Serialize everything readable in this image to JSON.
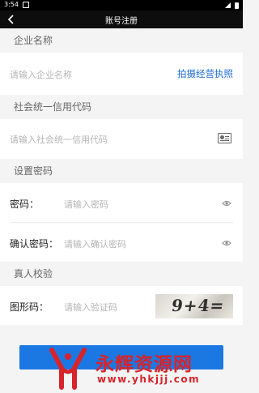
{
  "status_bar": {
    "time": "3:54"
  },
  "nav": {
    "title": "账号注册"
  },
  "sections": {
    "company": "企业名称",
    "credit_code": "社会统一信用代码",
    "password": "设置密码",
    "verify": "真人校验"
  },
  "company": {
    "placeholder": "请输入企业名称",
    "action_label": "拍摄经营执照"
  },
  "credit_code": {
    "placeholder": "请输入社会统一信用代码"
  },
  "password": {
    "label": "密码：",
    "placeholder": "请输入密码"
  },
  "confirm_password": {
    "label": "确认密码：",
    "placeholder": "请输入确认密码"
  },
  "captcha": {
    "label": "图形码：",
    "placeholder": "请输入验证码",
    "image_text": "9+4="
  },
  "watermark": {
    "title": "永辉资源网",
    "url": "www.yhkjjj.com"
  },
  "colors": {
    "accent": "#1f6bd6",
    "button": "#1b78e2",
    "watermark": "#d8232a"
  }
}
